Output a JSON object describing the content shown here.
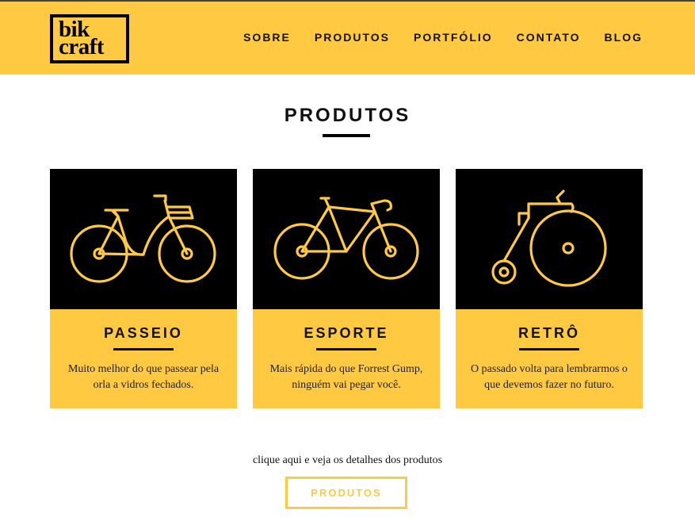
{
  "header": {
    "logo_line1": "bik",
    "logo_line2": "craft",
    "nav": [
      "SOBRE",
      "PRODUTOS",
      "PORTFÓLIO",
      "CONTATO",
      "BLOG"
    ]
  },
  "main": {
    "title": "PRODUTOS",
    "products": [
      {
        "name": "PASSEIO",
        "description": "Muito melhor do que passear pela orla a vidros fechados.",
        "icon": "city-bike-icon"
      },
      {
        "name": "ESPORTE",
        "description": "Mais rápida do que Forrest Gump, ninguém vai pegar você.",
        "icon": "road-bike-icon"
      },
      {
        "name": "RETRÔ",
        "description": "O passado volta para lembrarmos o que devemos fazer no futuro.",
        "icon": "penny-farthing-icon"
      }
    ],
    "cta_text": "clique aqui e veja os detalhes dos produtos",
    "cta_button": "PRODUTOS"
  },
  "colors": {
    "accent": "#FFC942",
    "dark": "#000000",
    "background": "#FFFFFF"
  }
}
